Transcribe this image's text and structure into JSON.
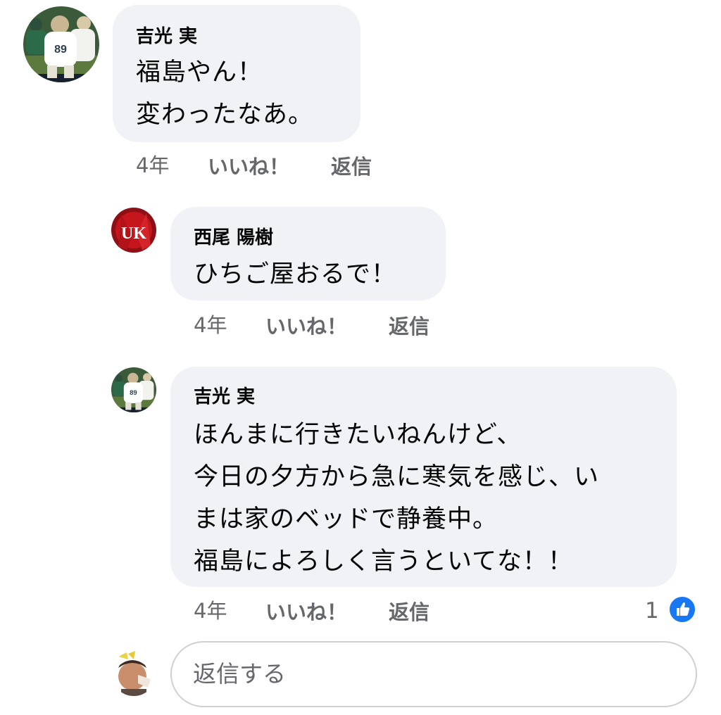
{
  "comments": [
    {
      "author": "吉光 実",
      "lines": [
        "福島やん！",
        "変わったなあ。"
      ],
      "time": "4年",
      "like_label": "いいね！",
      "reply_label": "返信"
    },
    {
      "author": "西尾 陽樹",
      "lines": [
        "ひちご屋おるで！"
      ],
      "time": "4年",
      "like_label": "いいね！",
      "reply_label": "返信"
    },
    {
      "author": "吉光 実",
      "lines": [
        "ほんまに行きたいねんけど、",
        "今日の夕方から急に寒気を感じ、い",
        "まは家のベッドで静養中。",
        "福島によろしく言うといてな！！"
      ],
      "time": "4年",
      "like_label": "いいね！",
      "reply_label": "返信",
      "reaction_count": "1",
      "reaction_icon": "thumbs-up-icon"
    }
  ],
  "reply_box": {
    "placeholder": "返信する"
  },
  "colors": {
    "bubble": "#f0f2f5",
    "meta_text": "#65676b",
    "like_blue": "#1877f2"
  }
}
